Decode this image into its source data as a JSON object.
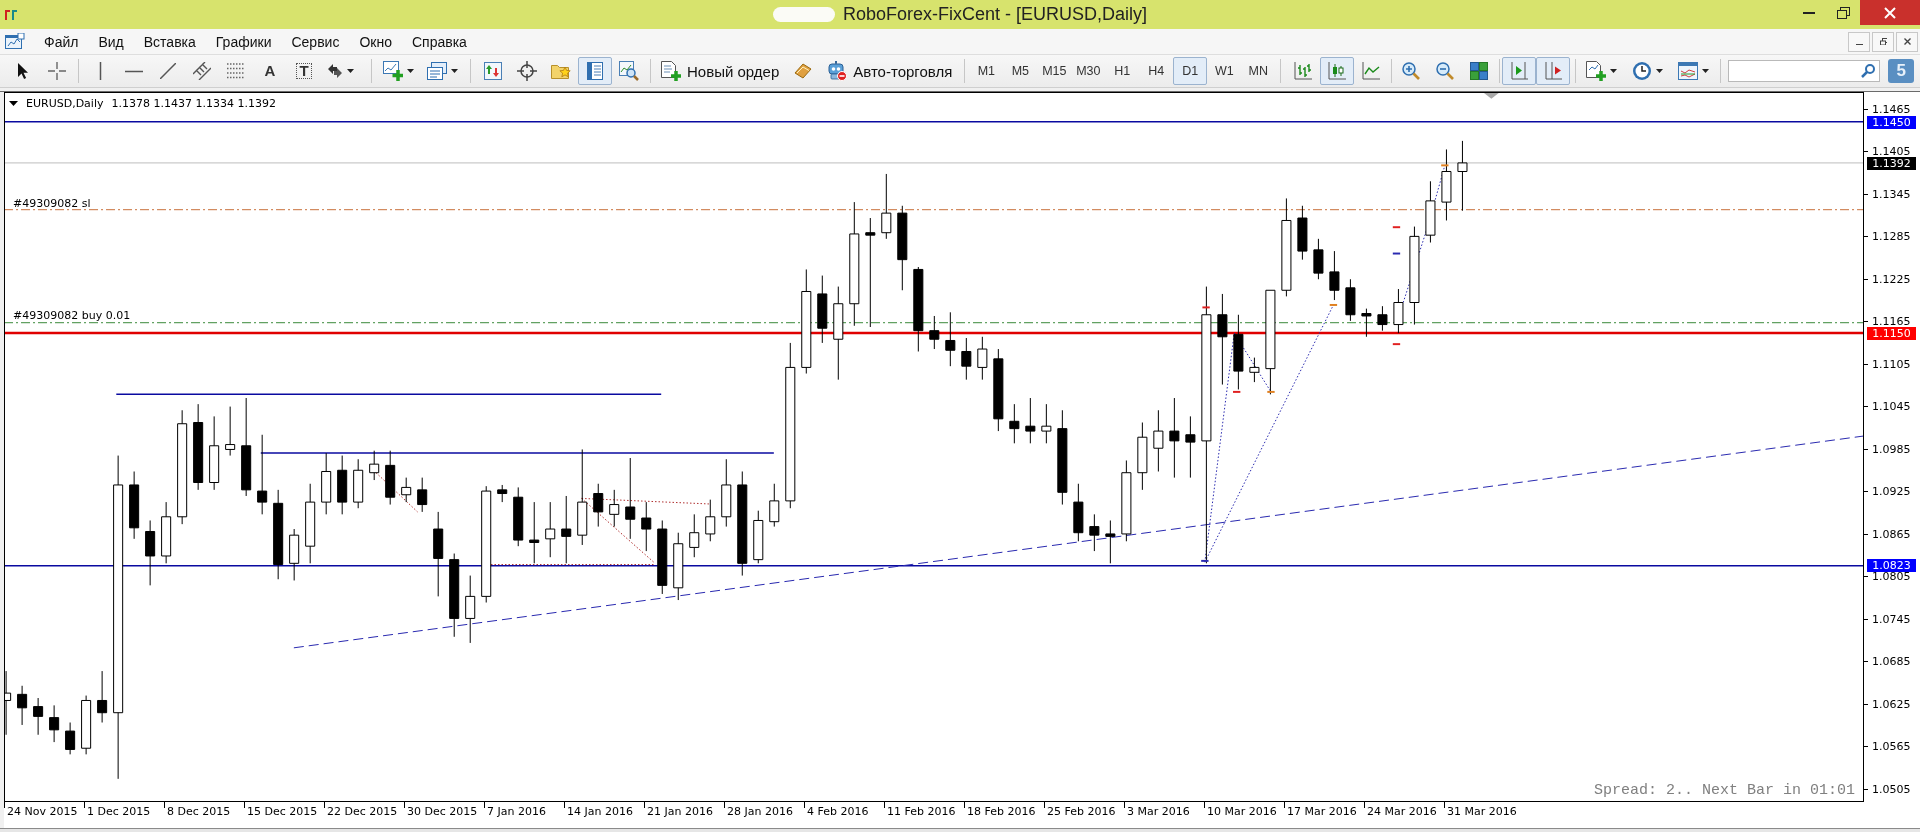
{
  "window": {
    "title": "RoboForex-FixCent - [EURUSD,Daily]"
  },
  "menu": [
    {
      "label": "Файл"
    },
    {
      "label": "Вид"
    },
    {
      "label": "Вставка"
    },
    {
      "label": "Графики"
    },
    {
      "label": "Сервис"
    },
    {
      "label": "Окно"
    },
    {
      "label": "Справка"
    }
  ],
  "toolbar": [
    {
      "items": [
        {
          "kind": "icon",
          "pressed": false
        },
        {
          "kind": "icon",
          "pressed": false
        }
      ]
    },
    {
      "items": [
        {
          "kind": "icon",
          "pressed": false
        },
        {
          "kind": "icon",
          "pressed": false
        },
        {
          "kind": "icon",
          "pressed": false
        },
        {
          "kind": "icon",
          "pressed": false
        },
        {
          "kind": "icon",
          "pressed": false
        },
        {
          "kind": "glyph",
          "glyph": "A",
          "pressed": false
        },
        {
          "kind": "boxed-glyph",
          "glyph": "T",
          "pressed": false
        },
        {
          "kind": "menu",
          "pressed": false
        }
      ]
    },
    {
      "items": [
        {
          "kind": "menu",
          "pressed": false
        },
        {
          "kind": "menu",
          "pressed": false
        }
      ]
    },
    {
      "items": [
        {
          "kind": "icon",
          "pressed": false
        },
        {
          "kind": "icon",
          "pressed": false
        },
        {
          "kind": "icon",
          "pressed": false
        },
        {
          "kind": "icon",
          "pressed": true
        },
        {
          "kind": "icon",
          "pressed": false
        }
      ]
    },
    {
      "items": [
        {
          "kind": "text",
          "label": "Новый ордер"
        },
        {
          "kind": "icon",
          "pressed": false
        },
        {
          "kind": "text",
          "label": "Авто-торговля"
        }
      ]
    },
    {
      "items": [
        {
          "kind": "timeframe",
          "label": "M1",
          "selected": false
        },
        {
          "kind": "timeframe",
          "label": "M5",
          "selected": false
        },
        {
          "kind": "timeframe",
          "label": "M15",
          "selected": false
        },
        {
          "kind": "timeframe",
          "label": "M30",
          "selected": false
        },
        {
          "kind": "timeframe",
          "label": "H1",
          "selected": false
        },
        {
          "kind": "timeframe",
          "label": "H4",
          "selected": false
        },
        {
          "kind": "timeframe",
          "label": "D1",
          "selected": true
        },
        {
          "kind": "timeframe",
          "label": "W1",
          "selected": false
        },
        {
          "kind": "timeframe",
          "label": "MN",
          "selected": false
        }
      ]
    },
    {
      "items": [
        {
          "kind": "icon",
          "pressed": false
        },
        {
          "kind": "icon",
          "pressed": true
        },
        {
          "kind": "icon",
          "pressed": false
        }
      ]
    },
    {
      "items": [
        {
          "kind": "icon",
          "pressed": false
        },
        {
          "kind": "icon",
          "pressed": false
        },
        {
          "kind": "icon",
          "pressed": false
        }
      ]
    },
    {
      "items": [
        {
          "kind": "icon",
          "pressed": true
        },
        {
          "kind": "icon",
          "pressed": true
        }
      ]
    },
    {
      "items": [
        {
          "kind": "menu",
          "pressed": false
        },
        {
          "kind": "menu",
          "pressed": false
        },
        {
          "kind": "menu",
          "pressed": false
        }
      ]
    },
    {
      "items": [
        {
          "kind": "search"
        },
        {
          "kind": "community",
          "glyph": "5"
        }
      ]
    }
  ],
  "chart": {
    "symbol": "EURUSD,Daily",
    "ohlc": "1.1378 1.1437 1.1334 1.1392",
    "order_labels": [
      "#49309082 sl",
      "#49309082 buy 0.01"
    ],
    "status": "Spread: 2.. Next Bar in 01:01",
    "price_axis": [
      "1.1465",
      "1.1405",
      "1.1345",
      "1.1285",
      "1.1225",
      "1.1165",
      "1.1105",
      "1.1045",
      "1.0985",
      "1.0925",
      "1.0865",
      "1.0805",
      "1.0745",
      "1.0685",
      "1.0625",
      "1.0565",
      "1.0505"
    ],
    "price_tags": [
      {
        "value": "1.1450",
        "color": "#0000ff"
      },
      {
        "value": "1.1392",
        "color": "#000000"
      },
      {
        "value": "1.1150",
        "color": "#ff0000"
      },
      {
        "value": "1.0823",
        "color": "#0000ff"
      }
    ],
    "time_axis": [
      "24 Nov 2015",
      "1 Dec 2015",
      "8 Dec 2015",
      "15 Dec 2015",
      "22 Dec 2015",
      "30 Dec 2015",
      "7 Jan 2016",
      "14 Jan 2016",
      "21 Jan 2016",
      "28 Jan 2016",
      "4 Feb 2016",
      "11 Feb 2016",
      "18 Feb 2016",
      "25 Feb 2016",
      "3 Mar 2016",
      "10 Mar 2016",
      "17 Mar 2016",
      "24 Mar 2016",
      "31 Mar 2016"
    ]
  }
}
